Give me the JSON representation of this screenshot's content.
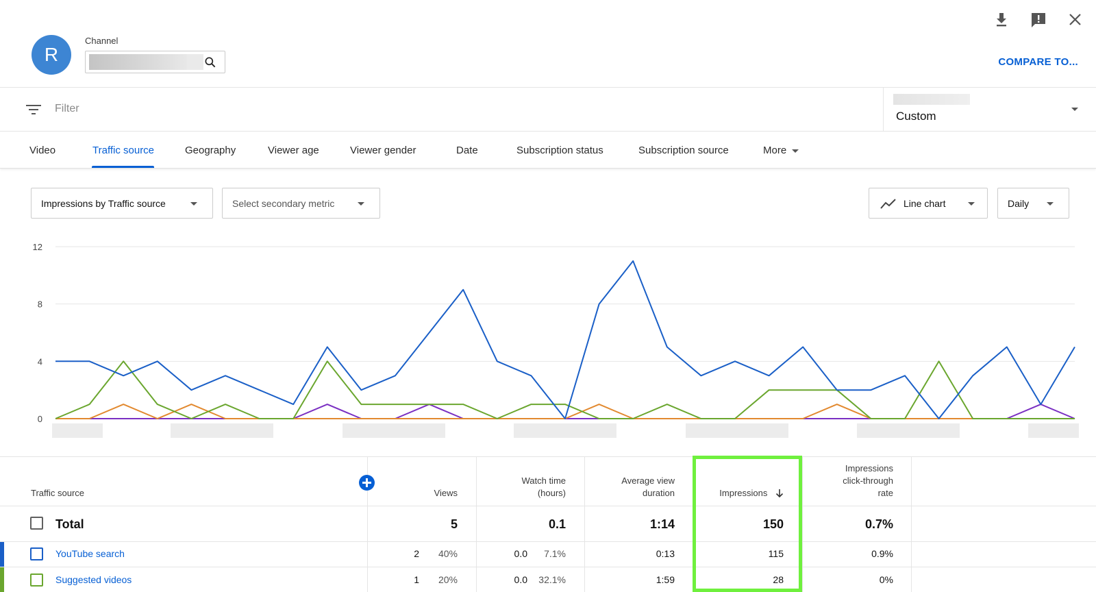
{
  "header": {
    "avatar_letter": "R",
    "channel_label": "Channel",
    "compare_label": "COMPARE TO...",
    "icons": [
      "download-icon",
      "feedback-icon",
      "close-icon",
      "search-icon"
    ]
  },
  "filter": {
    "placeholder": "Filter",
    "date_range": "Custom"
  },
  "tabs": [
    {
      "label": "Video"
    },
    {
      "label": "Traffic source"
    },
    {
      "label": "Geography"
    },
    {
      "label": "Viewer age"
    },
    {
      "label": "Viewer gender"
    },
    {
      "label": "Date"
    },
    {
      "label": "Subscription status"
    },
    {
      "label": "Subscription source"
    },
    {
      "label": "More"
    }
  ],
  "active_tab": "Traffic source",
  "controls": {
    "primary_metric": "Impressions by Traffic source",
    "secondary_metric": "Select secondary metric",
    "chart_type": "Line chart",
    "interval": "Daily"
  },
  "chart_data": {
    "type": "line",
    "y_ticks": [
      "12",
      "8",
      "4",
      "0"
    ],
    "ylim": [
      0,
      12
    ],
    "grid": true,
    "x_count": 30,
    "series": [
      {
        "color": "#1a5fc7",
        "values": [
          4,
          4,
          3,
          4,
          2,
          3,
          2,
          1,
          5,
          2,
          3,
          6,
          9,
          4,
          3,
          0,
          8,
          11,
          5,
          3,
          4,
          3,
          5,
          2,
          2,
          3,
          0,
          3,
          5,
          1,
          5
        ]
      },
      {
        "color": "#6aa62e",
        "values": [
          0,
          1,
          4,
          1,
          0,
          1,
          0,
          0,
          4,
          1,
          1,
          1,
          1,
          0,
          1,
          1,
          0,
          0,
          1,
          0,
          0,
          2,
          2,
          2,
          0,
          0,
          4,
          0,
          0,
          0,
          0
        ]
      },
      {
        "color": "#e2892f",
        "values": [
          0,
          0,
          1,
          0,
          1,
          0,
          0,
          0,
          0,
          0,
          0,
          0,
          0,
          0,
          0,
          0,
          1,
          0,
          0,
          0,
          0,
          0,
          0,
          1,
          0,
          0,
          0,
          0,
          0,
          0,
          0
        ]
      },
      {
        "color": "#7a2fc2",
        "values": [
          0,
          0,
          0,
          0,
          0,
          0,
          0,
          0,
          1,
          0,
          0,
          1,
          0,
          0,
          0,
          0,
          0,
          0,
          0,
          0,
          0,
          0,
          0,
          0,
          0,
          0,
          0,
          0,
          0,
          1,
          0
        ]
      }
    ]
  },
  "table": {
    "headers": {
      "traffic_source": "Traffic source",
      "views": "Views",
      "watch_time_1": "Watch time",
      "watch_time_2": "(hours)",
      "avd_1": "Average view",
      "avd_2": "duration",
      "impressions": "Impressions",
      "ctr_1": "Impressions",
      "ctr_2": "click-through",
      "ctr_3": "rate"
    },
    "total": {
      "label": "Total",
      "views": "5",
      "watch_time": "0.1",
      "avd": "1:14",
      "impressions": "150",
      "ctr": "0.7%"
    },
    "rows": [
      {
        "label": "YouTube search",
        "views": "2",
        "views_pct": "40%",
        "watch_time": "0.0",
        "watch_pct": "7.1%",
        "avd": "0:13",
        "impressions": "115",
        "ctr": "0.9%",
        "color": "#1a5fc7"
      },
      {
        "label": "Suggested videos",
        "views": "1",
        "views_pct": "20%",
        "watch_time": "0.0",
        "watch_pct": "32.1%",
        "avd": "1:59",
        "impressions": "28",
        "ctr": "0%",
        "color": "#6aa62e"
      }
    ]
  }
}
